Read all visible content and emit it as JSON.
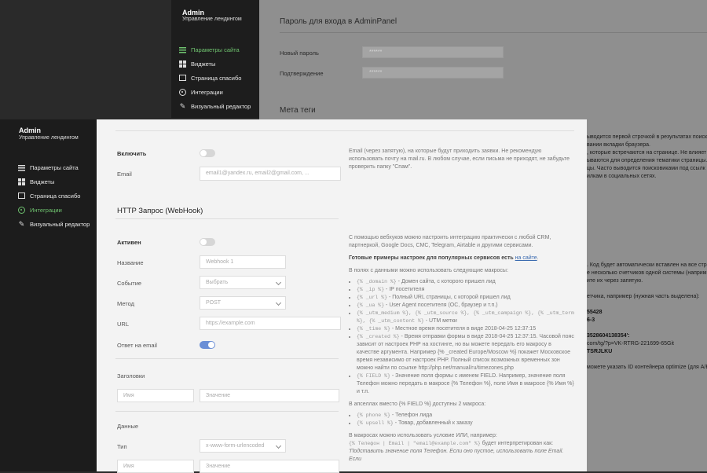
{
  "bg_sidebar": {
    "title": "Admin",
    "subtitle": "Управление лендингом",
    "items": [
      {
        "label": "Параметры сайта",
        "icon": "sliders-icon",
        "active": true
      },
      {
        "label": "Виджеты",
        "icon": "grid-icon",
        "active": false
      },
      {
        "label": "Страница спасибо",
        "icon": "square-icon",
        "active": false
      },
      {
        "label": "Интеграции",
        "icon": "circle-icon",
        "active": false
      },
      {
        "label": "Визуальный редактор",
        "icon": "pen-icon",
        "active": false
      }
    ]
  },
  "bg_content": {
    "password_heading": "Пароль для входа в AdminPanel",
    "new_password_label": "Новый пароль",
    "new_password_value": "******",
    "confirm_label": "Подтверждение",
    "confirm_value": "******",
    "meta_heading": "Мета теги",
    "right_lines": [
      "ыводится первой строчкой в результатах поиско",
      "вании вкладки браузера.",
      "",
      ", которые встречаются на странице. Не влияет",
      "ываются для определения тематики страницы.",
      "",
      "цы. Часто выводится поисковиками под ссылк",
      "илкам в социальных сетях."
    ],
    "right_lines2": [
      ". Код будет автоматически вставлен на все стр",
      "е несколько счетчиков одной системы (наприм",
      "ите их через запятую.",
      "",
      "етчика, например (нужная часть выделена):",
      "",
      "55428",
      "6-3",
      "",
      "3528604138354':",
      "com/tg/?p=VK-RTRG-221699-65Git",
      "TSRJLKU",
      "",
      "можете указать ID контейнера optimize (для A/B"
    ]
  },
  "fg_sidebar": {
    "title": "Admin",
    "subtitle": "Управление лендингом",
    "items": [
      {
        "label": "Параметры сайта",
        "icon": "sliders-icon",
        "active": false
      },
      {
        "label": "Виджеты",
        "icon": "grid-icon",
        "active": false
      },
      {
        "label": "Страница спасибо",
        "icon": "square-icon",
        "active": false
      },
      {
        "label": "Интеграции",
        "icon": "circle-icon",
        "active": true
      },
      {
        "label": "Визуальный редактор",
        "icon": "pen-icon",
        "active": false
      }
    ]
  },
  "email_section": {
    "enable_label": "Включить",
    "enable_on": false,
    "email_label": "Email",
    "email_placeholder": "email1@yandex.ru, email2@gmail.com, ...",
    "help": "Email (через запятую), на которые будут приходить заявки. Не рекомендую использовать почту на mail.ru. В любом случае, если письма не приходят, не забудьте проверить папку \"Спам\"."
  },
  "webhook": {
    "title": "HTTP Запрос (WebHook)",
    "active_label": "Активен",
    "active_on": false,
    "name_label": "Название",
    "name_placeholder": "Webhook 1",
    "event_label": "Событие",
    "event_value": "Выбрать",
    "method_label": "Метод",
    "method_value": "POST",
    "url_label": "URL",
    "url_placeholder": "https://example.com",
    "email_answer_label": "Ответ на email",
    "email_answer_on": true,
    "headers_label": "Заголовки",
    "header_name_placeholder": "Имя",
    "header_value_placeholder": "Значение",
    "data_label": "Данные",
    "type_label": "Тип",
    "type_value": "x-www-form-urlencoded",
    "data_name_placeholder": "Имя",
    "data_value_placeholder": "Значение"
  },
  "help": {
    "p1": "С помощью вебхуков можно настроить интеграцию практически с любой CRM, партнеркой, Google Docs, CMC, Telegram, Airtable и другими сервисами.",
    "p2_bold": "Готовые примеры настроек для популярных сервисов есть",
    "p2_link": "на сайте",
    "p3": "В полях с данными можно использовать следующие макросы:",
    "macros": [
      {
        "code": "{% _domain %}",
        "text": " - Домен сайта, с которого пришел лид"
      },
      {
        "code": "{% _ip %}",
        "text": " - IP посетителя"
      },
      {
        "code": "{% _url %}",
        "text": " - Полный URL страницы, с которой пришел лид"
      },
      {
        "code": "{% _ua %}",
        "text": " - User Agent посетителя (ОС, браузер и т.п.)"
      },
      {
        "code": "{% _utm_medium %}, {% _utm_source %}, {% _utm_campaign %}, {% _utm_term %}, {% _utm_content %}",
        "text": " - UTM метки"
      },
      {
        "code": "{% _time %}",
        "text": " - Местное время посетителя в виде 2018-04-25 12:37:15"
      },
      {
        "code": "{% _created %}",
        "text": " - Время отправки формы в виде 2018-04-25 12:37:15. Часовой пояс зависит от настроек PHP на хостинге, но вы можете передать его макросу в качестве аргумента. Например {% _created Europe/Moscow %} покажет Московское время независимо от настроек PHP. Полный список возможных временных зон можно найти по ссылке http://php.net/manual/ru/timezones.php"
      },
      {
        "code": "{% FIELD %}",
        "text": " - Значение поля формы с именем FIELD. Например, значение поля Телефон можно передать в макросе {% Телефон %}, поле Имя в макросе {% Имя %} и т.п."
      }
    ],
    "p4": "В апселлах вместо {% FIELD %} доступны 2 макроса:",
    "upsell": [
      {
        "code": "{% phone %}",
        "text": " - Телефон лида"
      },
      {
        "code": "{% upsell %}",
        "text": " - Товар, добавленный к заказу"
      }
    ],
    "p5": "В макросах можно использовать условие ИЛИ, например:",
    "p6_code": "{% Телефон | Email | \"email@example.com\" %}",
    "p6_text": " будет интерпретирован как:",
    "p7": "'Подставить значение поля Телефон. Если оно пустое, использовать поле Email. Если"
  },
  "colors": {
    "accent_green": "#6fc36f",
    "toggle_on": "#6b8fd6",
    "link": "#3b6bb0"
  }
}
